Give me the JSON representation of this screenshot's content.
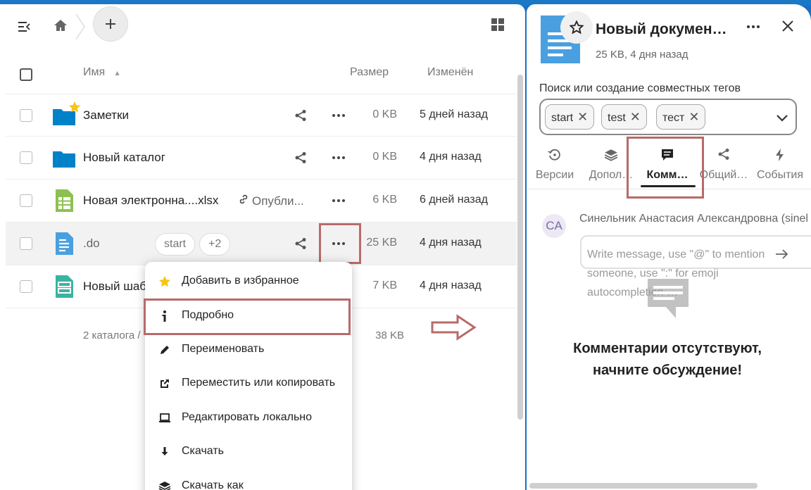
{
  "toolbar": {
    "menu_icon": "sidebar-toggle-icon",
    "home_icon": "home-icon",
    "add_icon": "plus-icon",
    "grid_icon": "grid-view-icon"
  },
  "table": {
    "headers": {
      "name": "Имя",
      "size": "Размер",
      "modified": "Изменён"
    },
    "rows": [
      {
        "name": "Заметки",
        "size": "0 KB",
        "modified": "5 дней назад",
        "icon": "folder-icon"
      },
      {
        "name": "Новый каталог",
        "size": "0 KB",
        "modified": "4 дня назад",
        "icon": "folder-icon"
      },
      {
        "name": "Новая электронна....xlsx",
        "published": "Опубли...",
        "size": "6 KB",
        "modified": "6 дней назад",
        "icon": "spreadsheet-icon"
      },
      {
        "name": ".do",
        "tags": [
          "start",
          "+2"
        ],
        "size": "25 KB",
        "modified": "4 дня назад",
        "icon": "document-icon"
      },
      {
        "name": "Новый шабл",
        "size": "7 KB",
        "modified": "4 дня назад",
        "icon": "template-icon"
      }
    ],
    "footer": {
      "summary": "2 каталога /",
      "total_size": "38 KB"
    }
  },
  "context_menu": {
    "items": [
      {
        "label": "Добавить в избранное",
        "icon": "star-icon"
      },
      {
        "label": "Подробно",
        "icon": "info-icon"
      },
      {
        "label": "Переименовать",
        "icon": "pencil-icon"
      },
      {
        "label": "Переместить или копировать",
        "icon": "move-icon"
      },
      {
        "label": "Редактировать локально",
        "icon": "laptop-icon"
      },
      {
        "label": "Скачать",
        "icon": "download-icon"
      },
      {
        "label": "Скачать как",
        "icon": "layers-icon"
      }
    ]
  },
  "sidebar": {
    "title": "Новый докумен…",
    "subtitle": "25 KB, 4 дня назад",
    "tags_label": "Поиск или создание совместных тегов",
    "tags": [
      "start",
      "test",
      "тест"
    ],
    "tabs": [
      {
        "label": "Версии",
        "icon": "history-icon"
      },
      {
        "label": "Допол…",
        "icon": "layers-icon"
      },
      {
        "label": "Комм…",
        "icon": "comment-icon",
        "active": true
      },
      {
        "label": "Общий…",
        "icon": "share-icon"
      },
      {
        "label": "События",
        "icon": "flash-icon"
      }
    ],
    "comments": {
      "avatar_initials": "CA",
      "author": "Синельник Анастасия Александровна (sinel",
      "placeholder": "Write message, use \"@\" to mention someone, use \":\" for emoji autocompletion …",
      "empty_text": "Комментарии отсутствуют, начните обсуждение!"
    }
  },
  "colors": {
    "accent": "#1a78c6",
    "folder": "#0082c9",
    "spreadsheet": "#8cc152",
    "document": "#4a9fe0",
    "template": "#3bb3a1",
    "annotation": "#b86a6a",
    "favorite": "#f5c518"
  }
}
